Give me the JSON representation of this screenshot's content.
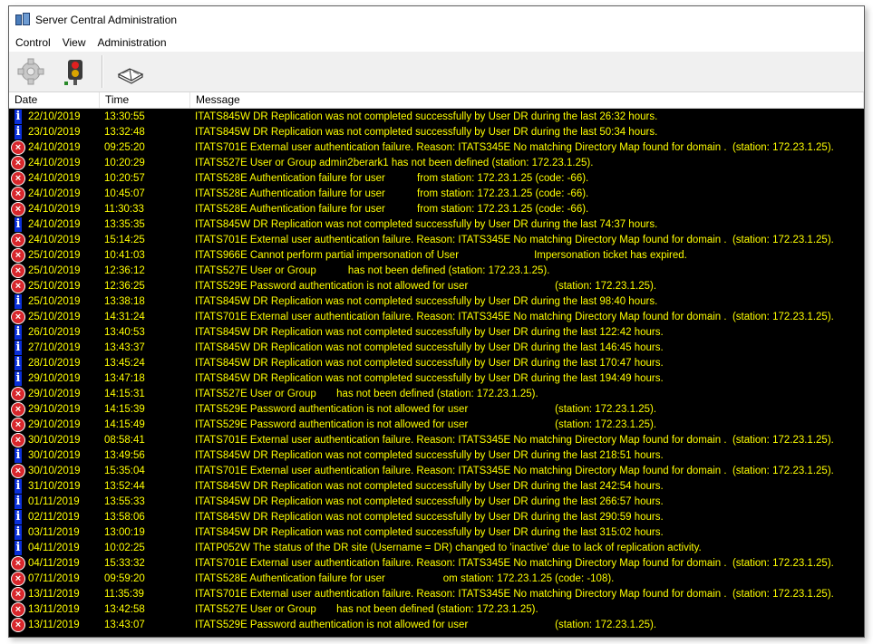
{
  "window": {
    "title": "Server Central Administration"
  },
  "menu": [
    "Control",
    "View",
    "Administration"
  ],
  "toolbar": {
    "buttons": [
      "gear-icon",
      "traffic-light-icon",
      "book-icon"
    ]
  },
  "columns": {
    "date": "Date",
    "time": "Time",
    "message": "Message"
  },
  "colors": {
    "log_background": "#000000",
    "log_text": "#ffff00",
    "error_icon": "#d7262b",
    "info_icon": "#0a2fd8"
  },
  "rows": [
    {
      "type": "info",
      "date": "22/10/2019",
      "time": "13:30:55",
      "message": "ITATS845W DR Replication was not completed successfully by User DR during the last 26:32 hours."
    },
    {
      "type": "info",
      "date": "23/10/2019",
      "time": "13:32:48",
      "message": "ITATS845W DR Replication was not completed successfully by User DR during the last 50:34 hours."
    },
    {
      "type": "error",
      "date": "24/10/2019",
      "time": "09:25:20",
      "message": "ITATS701E External user authentication failure. Reason: ITATS345E No matching Directory Map found for domain .  (station: 172.23.1.25)."
    },
    {
      "type": "error",
      "date": "24/10/2019",
      "time": "10:20:29",
      "message": "ITATS527E User or Group admin2berark1 has not been defined (station: 172.23.1.25)."
    },
    {
      "type": "error",
      "date": "24/10/2019",
      "time": "10:20:57",
      "message": "ITATS528E Authentication failure for user           from station: 172.23.1.25 (code: -66)."
    },
    {
      "type": "error",
      "date": "24/10/2019",
      "time": "10:45:07",
      "message": "ITATS528E Authentication failure for user           from station: 172.23.1.25 (code: -66)."
    },
    {
      "type": "error",
      "date": "24/10/2019",
      "time": "11:30:33",
      "message": "ITATS528E Authentication failure for user           from station: 172.23.1.25 (code: -66)."
    },
    {
      "type": "info",
      "date": "24/10/2019",
      "time": "13:35:35",
      "message": "ITATS845W DR Replication was not completed successfully by User DR during the last 74:37 hours."
    },
    {
      "type": "error",
      "date": "24/10/2019",
      "time": "15:14:25",
      "message": "ITATS701E External user authentication failure. Reason: ITATS345E No matching Directory Map found for domain .  (station: 172.23.1.25)."
    },
    {
      "type": "error",
      "date": "25/10/2019",
      "time": "10:41:03",
      "message": "ITATS966E Cannot perform partial impersonation of User                          Impersonation ticket has expired."
    },
    {
      "type": "error",
      "date": "25/10/2019",
      "time": "12:36:12",
      "message": "ITATS527E User or Group           has not been defined (station: 172.23.1.25)."
    },
    {
      "type": "error",
      "date": "25/10/2019",
      "time": "12:36:25",
      "message": "ITATS529E Password authentication is not allowed for user                              (station: 172.23.1.25)."
    },
    {
      "type": "info",
      "date": "25/10/2019",
      "time": "13:38:18",
      "message": "ITATS845W DR Replication was not completed successfully by User DR during the last 98:40 hours."
    },
    {
      "type": "error",
      "date": "25/10/2019",
      "time": "14:31:24",
      "message": "ITATS701E External user authentication failure. Reason: ITATS345E No matching Directory Map found for domain .  (station: 172.23.1.25)."
    },
    {
      "type": "info",
      "date": "26/10/2019",
      "time": "13:40:53",
      "message": "ITATS845W DR Replication was not completed successfully by User DR during the last 122:42 hours."
    },
    {
      "type": "info",
      "date": "27/10/2019",
      "time": "13:43:37",
      "message": "ITATS845W DR Replication was not completed successfully by User DR during the last 146:45 hours."
    },
    {
      "type": "info",
      "date": "28/10/2019",
      "time": "13:45:24",
      "message": "ITATS845W DR Replication was not completed successfully by User DR during the last 170:47 hours."
    },
    {
      "type": "info",
      "date": "29/10/2019",
      "time": "13:47:18",
      "message": "ITATS845W DR Replication was not completed successfully by User DR during the last 194:49 hours."
    },
    {
      "type": "error",
      "date": "29/10/2019",
      "time": "14:15:31",
      "message": "ITATS527E User or Group       has not been defined (station: 172.23.1.25)."
    },
    {
      "type": "error",
      "date": "29/10/2019",
      "time": "14:15:39",
      "message": "ITATS529E Password authentication is not allowed for user                              (station: 172.23.1.25)."
    },
    {
      "type": "error",
      "date": "29/10/2019",
      "time": "14:15:49",
      "message": "ITATS529E Password authentication is not allowed for user                              (station: 172.23.1.25)."
    },
    {
      "type": "error",
      "date": "30/10/2019",
      "time": "08:58:41",
      "message": "ITATS701E External user authentication failure. Reason: ITATS345E No matching Directory Map found for domain .  (station: 172.23.1.25)."
    },
    {
      "type": "info",
      "date": "30/10/2019",
      "time": "13:49:56",
      "message": "ITATS845W DR Replication was not completed successfully by User DR during the last 218:51 hours."
    },
    {
      "type": "error",
      "date": "30/10/2019",
      "time": "15:35:04",
      "message": "ITATS701E External user authentication failure. Reason: ITATS345E No matching Directory Map found for domain .  (station: 172.23.1.25)."
    },
    {
      "type": "info",
      "date": "31/10/2019",
      "time": "13:52:44",
      "message": "ITATS845W DR Replication was not completed successfully by User DR during the last 242:54 hours."
    },
    {
      "type": "info",
      "date": "01/11/2019",
      "time": "13:55:33",
      "message": "ITATS845W DR Replication was not completed successfully by User DR during the last 266:57 hours."
    },
    {
      "type": "info",
      "date": "02/11/2019",
      "time": "13:58:06",
      "message": "ITATS845W DR Replication was not completed successfully by User DR during the last 290:59 hours."
    },
    {
      "type": "info",
      "date": "03/11/2019",
      "time": "13:00:19",
      "message": "ITATS845W DR Replication was not completed successfully by User DR during the last 315:02 hours."
    },
    {
      "type": "info",
      "date": "04/11/2019",
      "time": "10:02:25",
      "message": "ITATP052W The status of the DR site (Username = DR) changed to 'inactive' due to lack of replication activity."
    },
    {
      "type": "error",
      "date": "04/11/2019",
      "time": "15:33:32",
      "message": "ITATS701E External user authentication failure. Reason: ITATS345E No matching Directory Map found for domain .  (station: 172.23.1.25)."
    },
    {
      "type": "error",
      "date": "07/11/2019",
      "time": "09:59:20",
      "message": "ITATS528E Authentication failure for user                    om station: 172.23.1.25 (code: -108)."
    },
    {
      "type": "error",
      "date": "13/11/2019",
      "time": "11:35:39",
      "message": "ITATS701E External user authentication failure. Reason: ITATS345E No matching Directory Map found for domain .  (station: 172.23.1.25)."
    },
    {
      "type": "error",
      "date": "13/11/2019",
      "time": "13:42:58",
      "message": "ITATS527E User or Group       has not been defined (station: 172.23.1.25)."
    },
    {
      "type": "error",
      "date": "13/11/2019",
      "time": "13:43:07",
      "message": "ITATS529E Password authentication is not allowed for user                              (station: 172.23.1.25)."
    }
  ]
}
